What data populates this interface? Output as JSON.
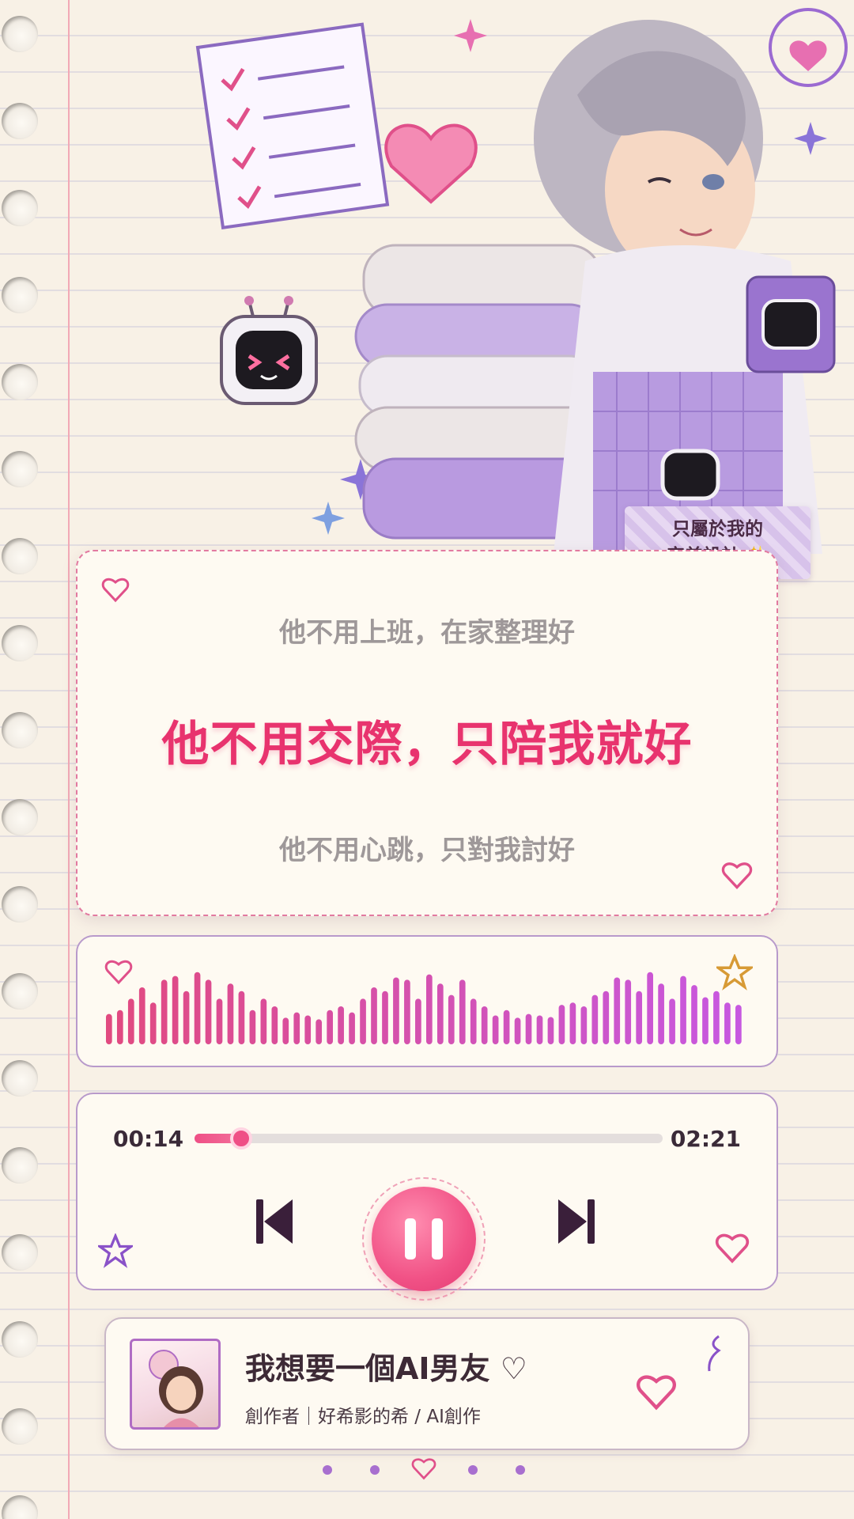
{
  "illustration": {
    "tag_label_line1": "只屬於我的",
    "tag_label_line2": "完美設計 ✨"
  },
  "lyrics": {
    "previous": "他不用上班，在家整理好",
    "current": "他不用交際，只陪我就好",
    "next": "他不用心跳，只對我討好"
  },
  "player": {
    "current_time": "00:14",
    "total_time": "02:21",
    "progress": 0.1
  },
  "song": {
    "title": "我想要一個AI男友 ♡",
    "meta": "創作者｜好希影的希 / AI創作"
  },
  "pagination": {
    "total": 5,
    "active": 3
  },
  "colors": {
    "accent_pink": "#e8336e",
    "purple": "#a86fcf",
    "waveform_start": "#e14a80",
    "waveform_end": "#c758e0"
  },
  "icons": [
    "heart-icon",
    "star-icon",
    "previous-track-icon",
    "pause-icon",
    "next-track-icon"
  ]
}
